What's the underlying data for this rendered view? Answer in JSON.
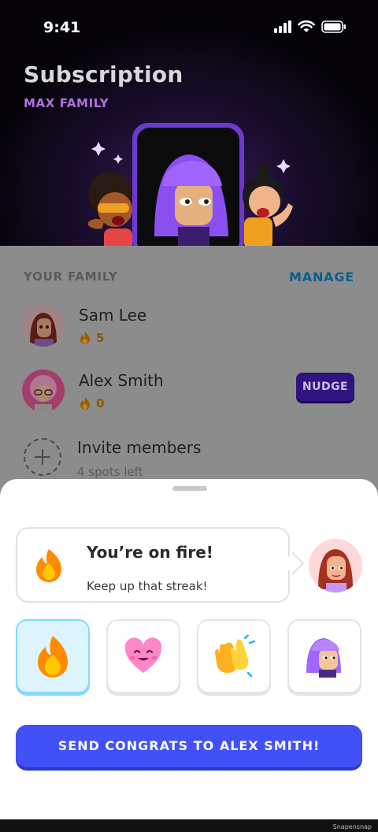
{
  "status_bar": {
    "time": "9:41"
  },
  "header": {
    "title": "Subscription",
    "plan": "MAX FAMILY"
  },
  "family": {
    "section_title": "YOUR FAMILY",
    "manage_label": "MANAGE",
    "members": [
      {
        "name": "Sam Lee",
        "streak": "5"
      },
      {
        "name": "Alex Smith",
        "streak": "0",
        "action_label": "NUDGE"
      }
    ],
    "invite": {
      "title": "Invite members",
      "subtitle": "4 spots left"
    }
  },
  "sheet": {
    "message_title": "You’re on fire!",
    "message_text": "Keep up that streak!",
    "reactions": [
      "fire-icon",
      "heart-icon",
      "clapping-hands-icon",
      "avatar-icon"
    ],
    "selected_reaction": 0,
    "send_label": "SEND CONGRATS TO ALEX SMITH!"
  },
  "watermark": "Snapensnap",
  "colors": {
    "accent": "#4150f7",
    "selected_reaction_bg": "#ddf4ff",
    "plan_label": "#b46ee0",
    "manage_link": "#0d5f8c",
    "nudge": "#2e1480"
  }
}
